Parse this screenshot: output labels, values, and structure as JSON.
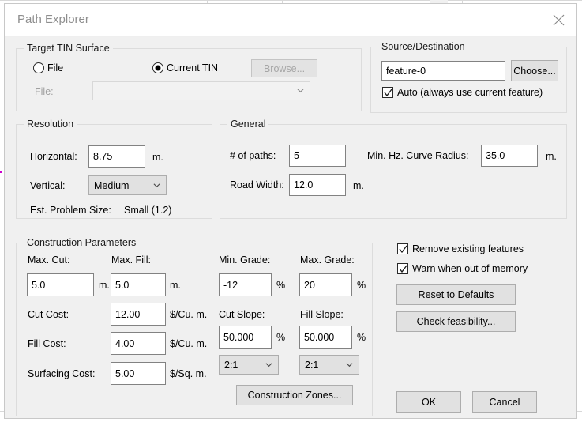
{
  "window": {
    "title": "Path Explorer",
    "close_icon": "close-icon"
  },
  "target_tin": {
    "group_title": "Target TIN Surface",
    "radio_file": "File",
    "radio_current": "Current TIN",
    "browse_button": "Browse...",
    "file_label": "File:",
    "file_combo_value": "",
    "selected": "Current TIN"
  },
  "source_destination": {
    "group_title": "Source/Destination",
    "feature_value": "feature-0",
    "choose_button": "Choose...",
    "auto_label": "Auto (always use current feature)",
    "auto_checked": true
  },
  "resolution": {
    "group_title": "Resolution",
    "horizontal_label": "Horizontal:",
    "horizontal_value": "8.75",
    "horizontal_unit": "m.",
    "vertical_label": "Vertical:",
    "vertical_value": "Medium",
    "problem_size_label": "Est. Problem Size:",
    "problem_size_value": "Small (1.2)"
  },
  "general": {
    "group_title": "General",
    "paths_label": "# of paths:",
    "paths_value": "5",
    "road_width_label": "Road Width:",
    "road_width_value": "12.0",
    "road_width_unit": "m.",
    "curve_radius_label": "Min. Hz. Curve Radius:",
    "curve_radius_value": "35.0",
    "curve_radius_unit": "m."
  },
  "construction": {
    "group_title": "Construction Parameters",
    "max_cut_label": "Max. Cut:",
    "max_cut_value": "5.0",
    "max_cut_unit": "m.",
    "max_fill_label": "Max. Fill:",
    "max_fill_value": "5.0",
    "max_fill_unit": "m.",
    "min_grade_label": "Min. Grade:",
    "min_grade_value": "-12",
    "min_grade_unit": "%",
    "max_grade_label": "Max. Grade:",
    "max_grade_value": "20",
    "max_grade_unit": "%",
    "cut_cost_label": "Cut Cost:",
    "cut_cost_value": "12.00",
    "cut_cost_unit": "$/Cu. m.",
    "fill_cost_label": "Fill Cost:",
    "fill_cost_value": "4.00",
    "fill_cost_unit": "$/Cu. m.",
    "surfacing_cost_label": "Surfacing Cost:",
    "surfacing_cost_value": "5.00",
    "surfacing_cost_unit": "$/Sq. m.",
    "cut_slope_label": "Cut Slope:",
    "cut_slope_value": "50.000",
    "cut_slope_unit": "%",
    "cut_slope_ratio": "2:1",
    "fill_slope_label": "Fill Slope:",
    "fill_slope_value": "50.000",
    "fill_slope_unit": "%",
    "fill_slope_ratio": "2:1",
    "zones_button": "Construction Zones..."
  },
  "options": {
    "remove_features_label": "Remove existing features",
    "remove_features_checked": true,
    "warn_memory_label": "Warn when out of memory",
    "warn_memory_checked": true,
    "reset_button": "Reset to Defaults",
    "feasibility_button": "Check feasibility..."
  },
  "footer": {
    "ok_button": "OK",
    "cancel_button": "Cancel"
  },
  "colors": {
    "dialog_bg": "#f0f0f0",
    "titlebar_bg": "#ffffff",
    "title_text": "#8e8e8e",
    "button_face": "#e1e1e1",
    "input_border": "#828282",
    "group_border": "#dcdcdc",
    "disabled_text": "#a0a0a0"
  }
}
